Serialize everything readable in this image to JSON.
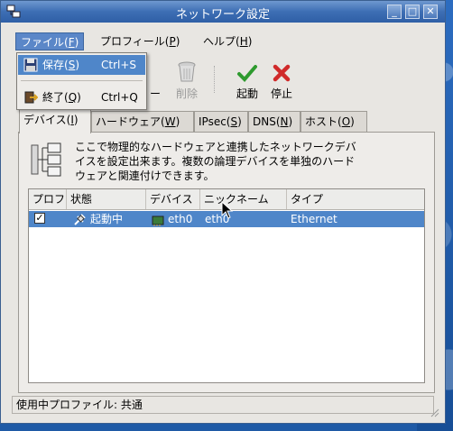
{
  "window": {
    "title": "ネットワーク設定"
  },
  "menubar": {
    "items": [
      {
        "label": "ファイル(",
        "key": "F",
        "end": ")"
      },
      {
        "label": "プロフィール(",
        "key": "P",
        "end": ")"
      },
      {
        "label": "ヘルプ(",
        "key": "H",
        "end": ")"
      }
    ]
  },
  "file_menu": {
    "save": {
      "label": "保存(",
      "key": "S",
      "end": ")",
      "accel": "Ctrl+S"
    },
    "quit": {
      "label": "終了(",
      "key": "Q",
      "end": ")",
      "accel": "Ctrl+Q"
    }
  },
  "toolbar": {
    "edit_fragment": "ー",
    "delete": "削除",
    "activate": "起動",
    "deactivate": "停止"
  },
  "tabs": [
    {
      "label": "デバイス(",
      "key": "I",
      "end": ")"
    },
    {
      "label": "ハードウェア(",
      "key": "W",
      "end": ")"
    },
    {
      "label": "IPsec(",
      "key": "S",
      "end": ")"
    },
    {
      "label": "DNS(",
      "key": "N",
      "end": ")"
    },
    {
      "label": "ホスト(",
      "key": "O",
      "end": ")"
    }
  ],
  "devices_panel": {
    "info_lines": [
      "ここで物理的なハードウェアと連携したネットワークデバ",
      "イスを設定出来ます。複数の論理デバイスを単独のハード",
      "ウェアと関連付けできます。"
    ],
    "columns": [
      "プロフ",
      "状態",
      "デバイス",
      "ニックネーム",
      "タイプ"
    ],
    "rows": [
      {
        "profile_checked": "✓",
        "status": "起動中",
        "device": "eth0",
        "nickname": "eth0",
        "type": "Ethernet"
      }
    ]
  },
  "statusbar": {
    "text": "使用中プロファイル: 共通"
  },
  "colors": {
    "selection": "#4f86c9",
    "titlebar": "#3d6eb4",
    "activate_green": "#2e9a2e",
    "deactivate_red": "#d02a2a"
  }
}
